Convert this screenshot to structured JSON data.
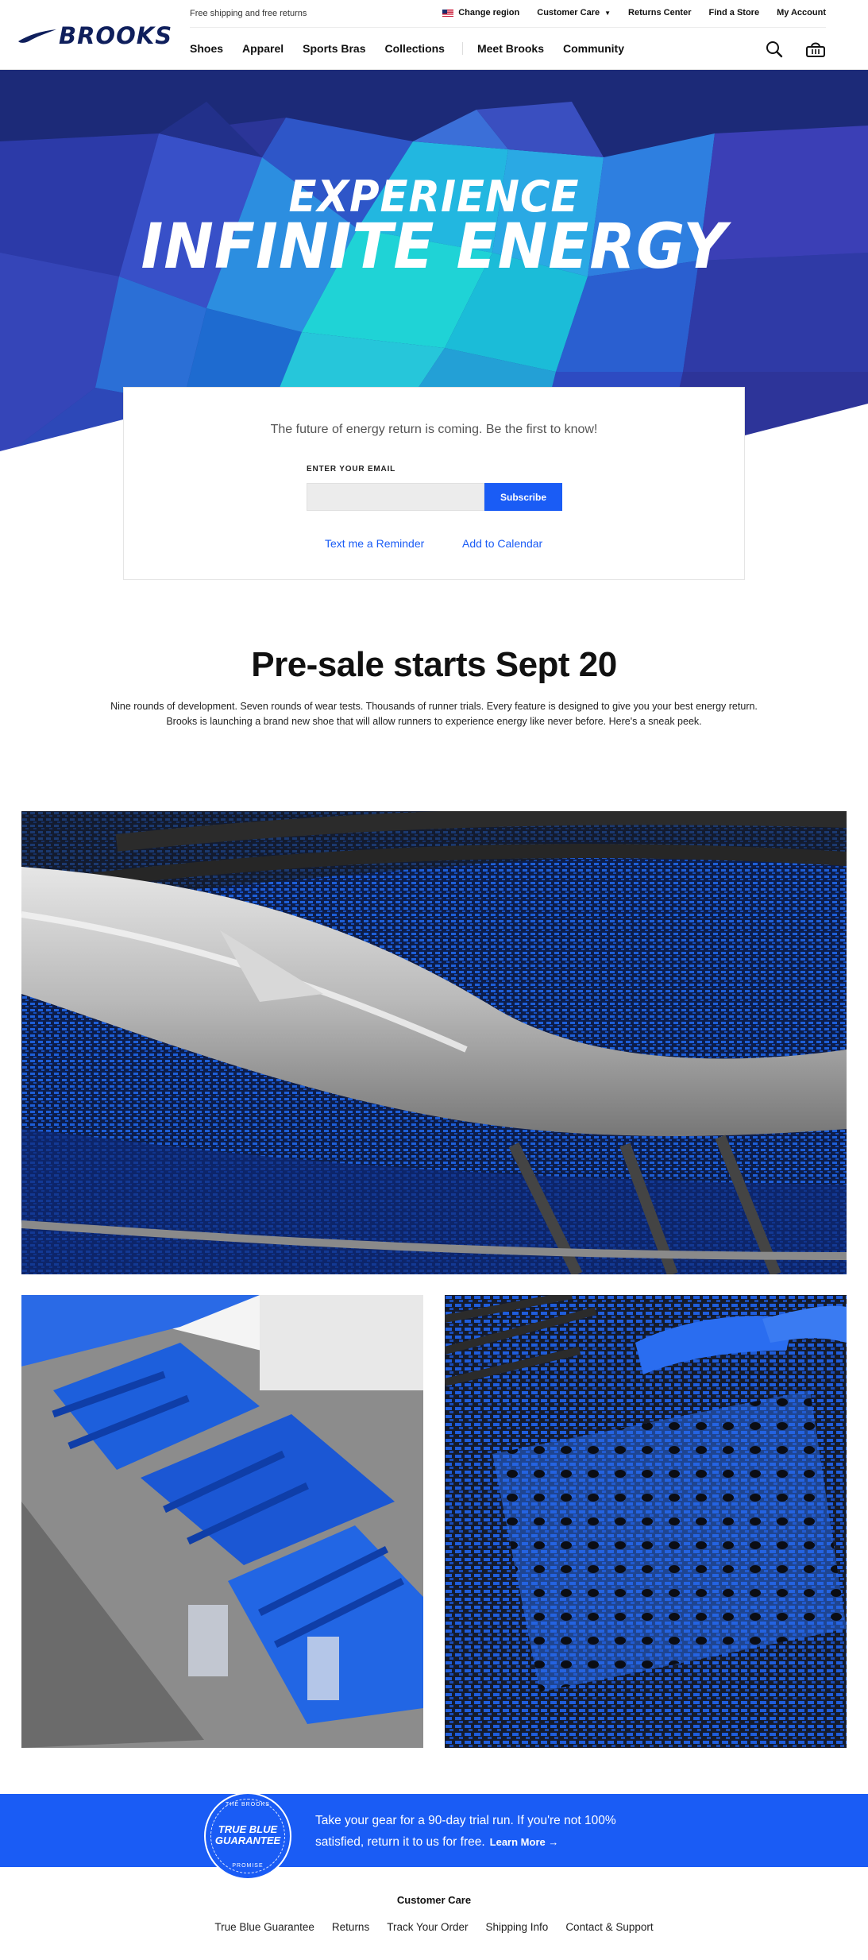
{
  "brand": {
    "name": "BROOKS"
  },
  "utility": {
    "shipping": "Free shipping and free returns",
    "change_region": "Change region",
    "customer_care": "Customer Care",
    "returns_center": "Returns Center",
    "find_store": "Find a Store",
    "my_account": "My Account"
  },
  "nav": {
    "items": [
      "Shoes",
      "Apparel",
      "Sports Bras",
      "Collections"
    ],
    "secondary": [
      "Meet Brooks",
      "Community"
    ]
  },
  "icons": {
    "search": "search-icon",
    "cart": "shopping-cart-icon",
    "region_flag": "us-flag-icon"
  },
  "hero": {
    "line1": "EXPERIENCE",
    "line2": "INFINITE ENERGY"
  },
  "signup": {
    "lead": "The future of energy return is coming. Be the first to know!",
    "email_label": "ENTER YOUR EMAIL",
    "email_value": "",
    "subscribe": "Subscribe",
    "text_reminder": "Text me a Reminder",
    "add_calendar": "Add to Calendar"
  },
  "presale": {
    "title": "Pre-sale starts Sept 20",
    "body": "Nine rounds of development. Seven rounds of wear tests. Thousands of runner trials. Every feature is designed to give you your best energy return. Brooks is launching a brand new shoe that will allow runners to experience energy like never before. Here's a sneak peek."
  },
  "guarantee": {
    "seal_top": "THE BROOKS",
    "seal_mid": "TRUE BLUE GUARANTEE",
    "seal_bottom": "PROMISE",
    "text": "Take your gear for a 90-day trial run. If you're not 100% satisfied, return it to us for free.",
    "learn_more": "Learn More →"
  },
  "footer": {
    "title": "Customer Care",
    "links": [
      "True Blue Guarantee",
      "Returns",
      "Track Your Order",
      "Shipping Info",
      "Contact & Support"
    ]
  },
  "colors": {
    "brand_navy": "#0f1f5c",
    "accent_blue": "#1a5cf5",
    "hero_teal": "#1fd3d6"
  }
}
